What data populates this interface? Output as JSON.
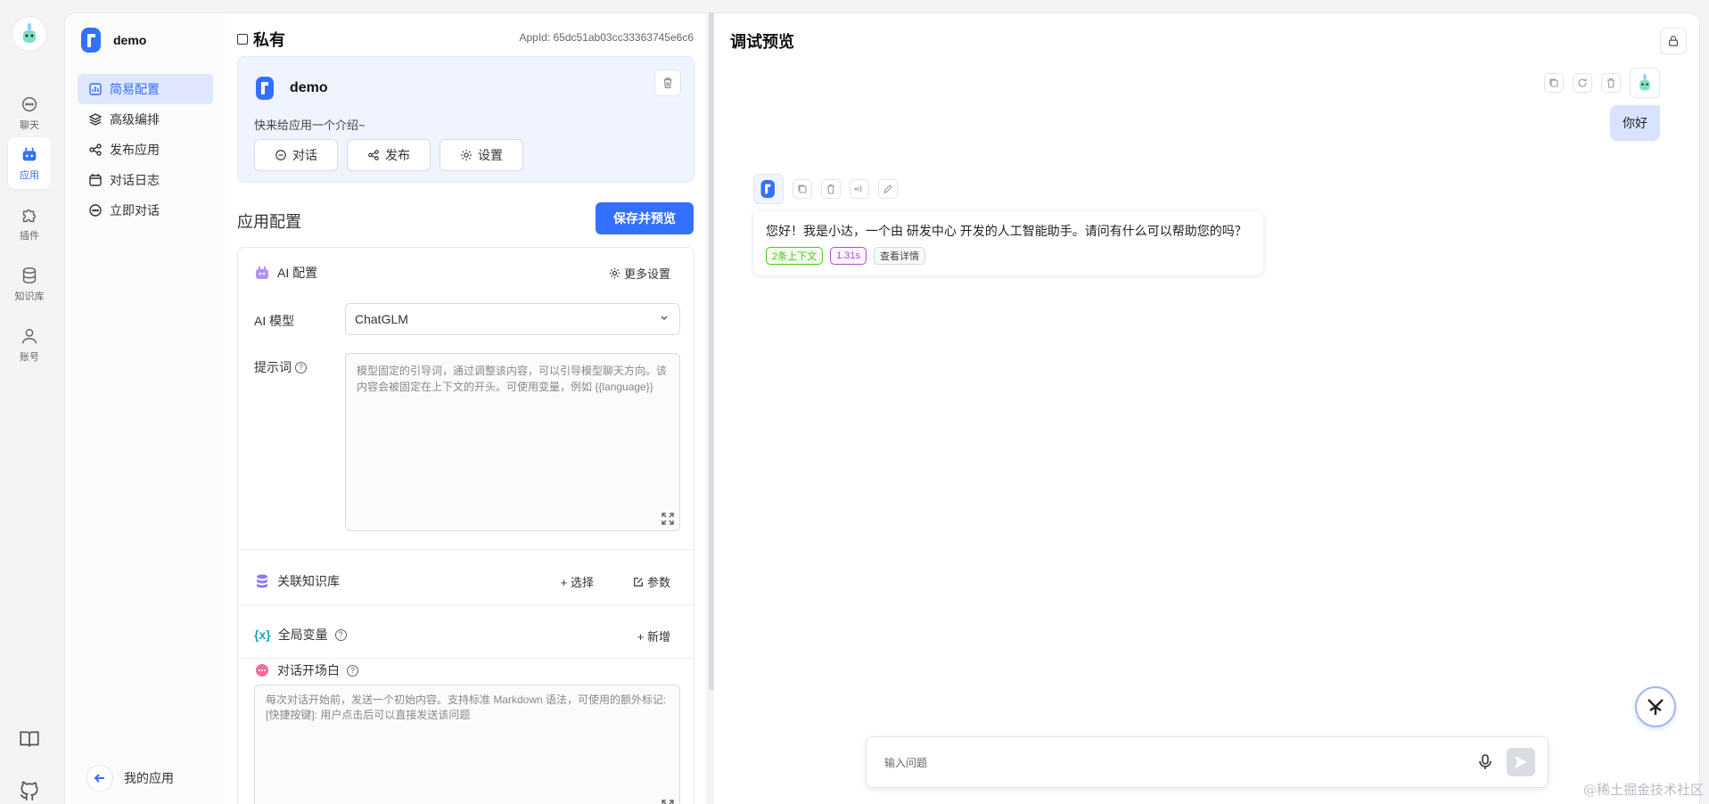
{
  "rail": {
    "items": [
      {
        "label": "聊天",
        "icon": "chat-icon"
      },
      {
        "label": "应用",
        "icon": "robot-icon"
      },
      {
        "label": "插件",
        "icon": "puzzle-icon"
      },
      {
        "label": "知识库",
        "icon": "database-icon"
      },
      {
        "label": "账号",
        "icon": "user-icon"
      }
    ],
    "active_index": 1,
    "accent": "#3370ff"
  },
  "app_sidebar": {
    "app_name": "demo",
    "nav": [
      {
        "label": "简易配置",
        "icon": "chart-icon"
      },
      {
        "label": "高级编排",
        "icon": "layers-icon"
      },
      {
        "label": "发布应用",
        "icon": "share-icon"
      },
      {
        "label": "对话日志",
        "icon": "calendar-icon"
      },
      {
        "label": "立即对话",
        "icon": "chat-icon"
      }
    ],
    "active_index": 0,
    "back_label": "我的应用"
  },
  "config": {
    "visibility": "私有",
    "appid": "AppId: 65dc51ab03cc33363745e6c6",
    "app_name": "demo",
    "intro_placeholder": "快来给应用一个介绍~",
    "actions": [
      "对话",
      "发布",
      "设置"
    ],
    "section_title": "应用配置",
    "save_label": "保存并预览",
    "ai": {
      "title": "AI 配置",
      "more": "更多设置",
      "model_label": "AI 模型",
      "model_value": "ChatGLM",
      "prompt_label": "提示词",
      "prompt_placeholder": "模型固定的引导词，通过调整该内容，可以引导模型聊天方向。该内容会被固定在上下文的开头。可使用变量，例如 {{language}}"
    },
    "kb": {
      "title": "关联知识库",
      "select": "+ 选择",
      "params": "参数"
    },
    "vars": {
      "title": "全局变量",
      "add": "+ 新增"
    },
    "opening": {
      "title": "对话开场白",
      "placeholder": "每次对话开始前，发送一个初始内容。支持标准 Markdown 语法，可使用的额外标记: [快捷按键]: 用户点击后可以直接发送该问题"
    }
  },
  "preview": {
    "title": "调试预览",
    "user_message": "你好",
    "bot_message": "您好！我是小达，一个由 研发中心 开发的人工智能助手。请问有什么可以帮助您的吗？",
    "tags": [
      "2条上下文",
      "1.31s",
      "查看详情"
    ],
    "input_placeholder": "输入问题"
  },
  "watermark": "@稀土掘金技术社区"
}
